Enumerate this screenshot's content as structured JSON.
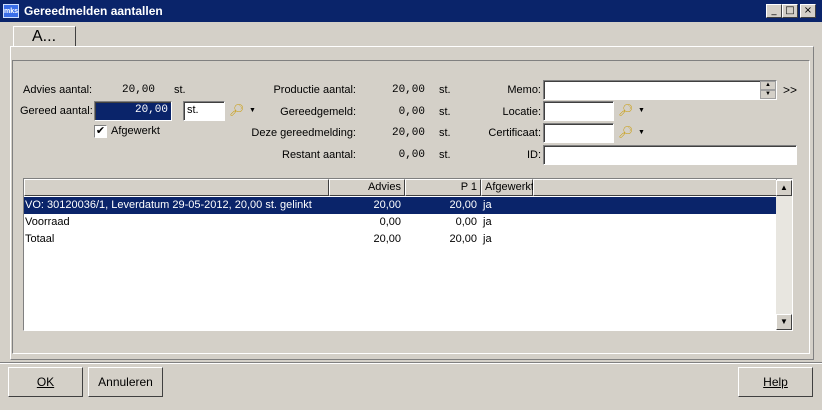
{
  "window": {
    "title": "Gereedmelden aantallen",
    "icon_label": "mks",
    "controls": {
      "minimize": "_",
      "maximize": "□",
      "close": "×"
    }
  },
  "tabs": [
    {
      "label": "A..."
    }
  ],
  "form": {
    "advies_label": "Advies aantal:",
    "advies_value": "20,00",
    "advies_unit": "st.",
    "gereed_label": "Gereed aantal:",
    "gereed_value": "20,00",
    "gereed_unit": "st.",
    "afgewerkt_label": "Afgewerkt",
    "afgewerkt_checked": true,
    "productie_label": "Productie aantal:",
    "productie_value": "20,00",
    "productie_unit": "st.",
    "gereedgemeld_label": "Gereedgemeld:",
    "gereedgemeld_value": "0,00",
    "gereedgemeld_unit": "st.",
    "deze_label": "Deze gereedmelding:",
    "deze_value": "20,00",
    "deze_unit": "st.",
    "restant_label": "Restant aantal:",
    "restant_value": "0,00",
    "restant_unit": "st.",
    "memo_label": "Memo:",
    "memo_value": "",
    "expand_label": ">>",
    "locatie_label": "Locatie:",
    "locatie_value": "",
    "certificaat_label": "Certificaat:",
    "certificaat_value": "",
    "id_label": "ID:",
    "id_value": ""
  },
  "table": {
    "columns": [
      "",
      "Advies",
      "P 1",
      "Afgewerkt"
    ],
    "rows": [
      {
        "desc": "VO: 30120036/1, Leverdatum 29-05-2012, 20,00 st. gelinkt",
        "advies": "20,00",
        "p1": "20,00",
        "afgewerkt": "ja",
        "selected": true
      },
      {
        "desc": "Voorraad",
        "advies": "0,00",
        "p1": "0,00",
        "afgewerkt": "ja",
        "selected": false
      },
      {
        "desc": "Totaal",
        "advies": "20,00",
        "p1": "20,00",
        "afgewerkt": "ja",
        "selected": false
      }
    ]
  },
  "buttons": {
    "ok": "OK",
    "cancel": "Annuleren",
    "help": "Help"
  },
  "icons": [
    "magnifier-icon",
    "dropdown-arrow-icon",
    "checkmark-icon",
    "scroll-up-icon",
    "scroll-down-icon"
  ],
  "colors": {
    "titlebar": "#0a246a",
    "selection": "#0a246a",
    "face": "#d4d0c8"
  }
}
